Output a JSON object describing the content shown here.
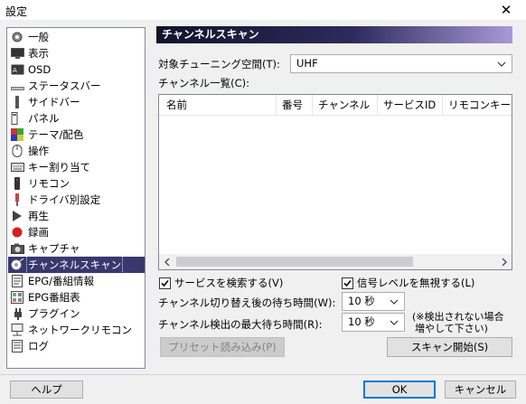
{
  "window": {
    "title": "設定",
    "close_glyph": "✕"
  },
  "sidebar": {
    "items": [
      {
        "label": "一般",
        "icon": "gear-icon"
      },
      {
        "label": "表示",
        "icon": "monitor-icon"
      },
      {
        "label": "OSD",
        "icon": "osd-icon"
      },
      {
        "label": "ステータスバー",
        "icon": "statusbar-icon"
      },
      {
        "label": "サイドバー",
        "icon": "sidebar-icon"
      },
      {
        "label": "パネル",
        "icon": "panel-icon"
      },
      {
        "label": "テーマ/配色",
        "icon": "palette-icon"
      },
      {
        "label": "操作",
        "icon": "mouse-icon"
      },
      {
        "label": "キー割り当て",
        "icon": "keyboard-icon"
      },
      {
        "label": "リモコン",
        "icon": "remote-icon"
      },
      {
        "label": "ドライバ別設定",
        "icon": "driver-icon"
      },
      {
        "label": "再生",
        "icon": "play-icon"
      },
      {
        "label": "録画",
        "icon": "record-icon"
      },
      {
        "label": "キャプチャ",
        "icon": "camera-icon"
      },
      {
        "label": "チャンネルスキャン",
        "icon": "scan-icon",
        "selected": true
      },
      {
        "label": "EPG/番組情報",
        "icon": "epg-icon"
      },
      {
        "label": "EPG番組表",
        "icon": "program-guide-icon"
      },
      {
        "label": "プラグイン",
        "icon": "plugin-icon"
      },
      {
        "label": "ネットワークリモコン",
        "icon": "network-remote-icon"
      },
      {
        "label": "ログ",
        "icon": "log-icon"
      }
    ]
  },
  "main": {
    "header": "チャンネルスキャン",
    "tuning_space": {
      "label": "対象チューニング空間(T):",
      "value": "UHF"
    },
    "channel_list": {
      "label": "チャンネル一覧(C):",
      "columns": [
        "名前",
        "番号",
        "チャンネル",
        "サービスID",
        "リモコンキー"
      ],
      "rows": []
    },
    "search_services": {
      "label": "サービスを検索する(V)",
      "checked": true
    },
    "ignore_signal": {
      "label": "信号レベルを無視する(L)",
      "checked": true
    },
    "switch_wait": {
      "label": "チャンネル切り替え後の待ち時間(W):",
      "value": "10 秒"
    },
    "detect_wait": {
      "label": "チャンネル検出の最大待ち時間(R):",
      "value": "10 秒"
    },
    "note": {
      "line1": "(※検出されない場合",
      "line2": "増やして下さい)"
    },
    "preset_button": "プリセット読み込み(P)",
    "scan_button": "スキャン開始(S)"
  },
  "footer": {
    "help": "ヘルプ",
    "ok": "OK",
    "cancel": "キャンセル"
  },
  "colors": {
    "selection": "#38386e",
    "header_gradient_start": "#14122a",
    "header_gradient_end": "#a79ad6",
    "focus_blue": "#0078d7"
  }
}
